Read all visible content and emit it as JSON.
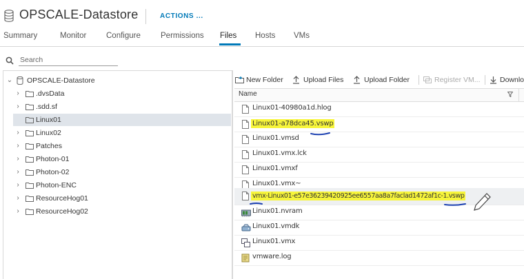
{
  "header": {
    "title": "OPSCALE-Datastore",
    "actions_label": "ACTIONS ..."
  },
  "tabs": [
    {
      "label": "Summary",
      "active": false
    },
    {
      "label": "Monitor",
      "active": false
    },
    {
      "label": "Configure",
      "active": false
    },
    {
      "label": "Permissions",
      "active": false
    },
    {
      "label": "Files",
      "active": true
    },
    {
      "label": "Hosts",
      "active": false
    },
    {
      "label": "VMs",
      "active": false
    }
  ],
  "search": {
    "placeholder": "Search",
    "value": ""
  },
  "tree": {
    "root": "OPSCALE-Datastore",
    "items": [
      {
        "label": ".dvsData",
        "selected": false
      },
      {
        "label": ".sdd.sf",
        "selected": false
      },
      {
        "label": "Linux01",
        "selected": true
      },
      {
        "label": "Linux02",
        "selected": false
      },
      {
        "label": "Patches",
        "selected": false
      },
      {
        "label": "Photon-01",
        "selected": false
      },
      {
        "label": "Photon-02",
        "selected": false
      },
      {
        "label": "Photon-ENC",
        "selected": false
      },
      {
        "label": "ResourceHog01",
        "selected": false
      },
      {
        "label": "ResourceHog02",
        "selected": false
      }
    ]
  },
  "toolbar": {
    "new_folder": "New Folder",
    "upload_files": "Upload Files",
    "upload_folder": "Upload Folder",
    "register_vm": "Register VM...",
    "download": "Downlo"
  },
  "grid": {
    "column_name": "Name",
    "files": [
      {
        "name": "Linux01-40980a1d.hlog",
        "icon": "file-icon",
        "highlighted": false
      },
      {
        "name": "Linux01-a78dca45.vswp",
        "icon": "file-icon",
        "highlighted": true
      },
      {
        "name": "Linux01.vmsd",
        "icon": "file-icon",
        "highlighted": false
      },
      {
        "name": "Linux01.vmx.lck",
        "icon": "file-icon",
        "highlighted": false
      },
      {
        "name": "Linux01.vmxf",
        "icon": "file-icon",
        "highlighted": false
      },
      {
        "name": "Linux01.vmx~",
        "icon": "file-icon",
        "highlighted": false
      },
      {
        "name": "vmx-Linux01-e57e36239420925ee6557aa8a7faclad1472af1c-1.vswp",
        "icon": "file-icon",
        "highlighted": true
      },
      {
        "name": "Linux01.nvram",
        "icon": "nvram-icon",
        "highlighted": false
      },
      {
        "name": "Linux01.vmdk",
        "icon": "disk-icon",
        "highlighted": false
      },
      {
        "name": "Linux01.vmx",
        "icon": "vm-icon",
        "highlighted": false
      },
      {
        "name": "vmware.log",
        "icon": "log-icon",
        "highlighted": false
      }
    ]
  },
  "colors": {
    "accent": "#0079b8",
    "highlight": "#f7f53a",
    "annotation_ink": "#1a3fb0",
    "selection": "#dfe4ea"
  }
}
